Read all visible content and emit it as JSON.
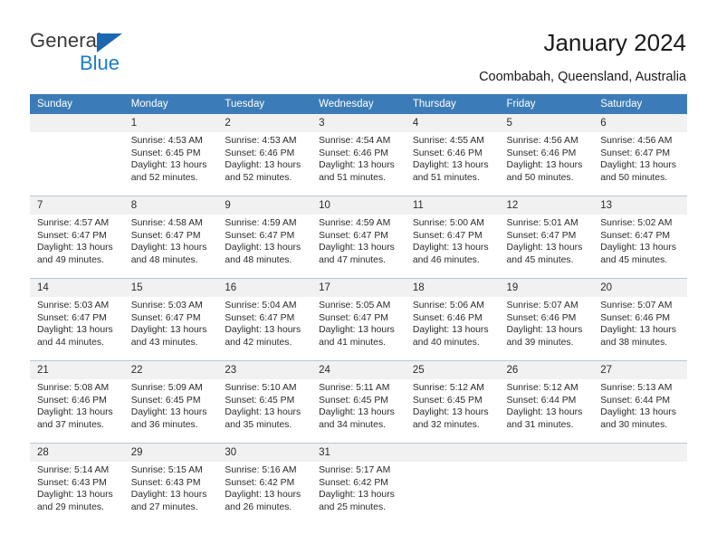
{
  "brand": {
    "word_one": "General",
    "word_two": "Blue",
    "accent_color": "#1b7cc4",
    "triangle_color": "#1b67b0"
  },
  "header": {
    "title": "January 2024",
    "subtitle": "Coombabah, Queensland, Australia",
    "header_bg_color": "#3b7cb8",
    "daynum_bg_color": "#f1f1f1"
  },
  "weekday_headers": [
    "Sunday",
    "Monday",
    "Tuesday",
    "Wednesday",
    "Thursday",
    "Friday",
    "Saturday"
  ],
  "weeks": [
    [
      {
        "day": "",
        "sunrise": "",
        "sunset": "",
        "daylight_line1": "",
        "daylight_line2": ""
      },
      {
        "day": "1",
        "sunrise": "Sunrise: 4:53 AM",
        "sunset": "Sunset: 6:45 PM",
        "daylight_line1": "Daylight: 13 hours",
        "daylight_line2": "and 52 minutes."
      },
      {
        "day": "2",
        "sunrise": "Sunrise: 4:53 AM",
        "sunset": "Sunset: 6:46 PM",
        "daylight_line1": "Daylight: 13 hours",
        "daylight_line2": "and 52 minutes."
      },
      {
        "day": "3",
        "sunrise": "Sunrise: 4:54 AM",
        "sunset": "Sunset: 6:46 PM",
        "daylight_line1": "Daylight: 13 hours",
        "daylight_line2": "and 51 minutes."
      },
      {
        "day": "4",
        "sunrise": "Sunrise: 4:55 AM",
        "sunset": "Sunset: 6:46 PM",
        "daylight_line1": "Daylight: 13 hours",
        "daylight_line2": "and 51 minutes."
      },
      {
        "day": "5",
        "sunrise": "Sunrise: 4:56 AM",
        "sunset": "Sunset: 6:46 PM",
        "daylight_line1": "Daylight: 13 hours",
        "daylight_line2": "and 50 minutes."
      },
      {
        "day": "6",
        "sunrise": "Sunrise: 4:56 AM",
        "sunset": "Sunset: 6:47 PM",
        "daylight_line1": "Daylight: 13 hours",
        "daylight_line2": "and 50 minutes."
      }
    ],
    [
      {
        "day": "7",
        "sunrise": "Sunrise: 4:57 AM",
        "sunset": "Sunset: 6:47 PM",
        "daylight_line1": "Daylight: 13 hours",
        "daylight_line2": "and 49 minutes."
      },
      {
        "day": "8",
        "sunrise": "Sunrise: 4:58 AM",
        "sunset": "Sunset: 6:47 PM",
        "daylight_line1": "Daylight: 13 hours",
        "daylight_line2": "and 48 minutes."
      },
      {
        "day": "9",
        "sunrise": "Sunrise: 4:59 AM",
        "sunset": "Sunset: 6:47 PM",
        "daylight_line1": "Daylight: 13 hours",
        "daylight_line2": "and 48 minutes."
      },
      {
        "day": "10",
        "sunrise": "Sunrise: 4:59 AM",
        "sunset": "Sunset: 6:47 PM",
        "daylight_line1": "Daylight: 13 hours",
        "daylight_line2": "and 47 minutes."
      },
      {
        "day": "11",
        "sunrise": "Sunrise: 5:00 AM",
        "sunset": "Sunset: 6:47 PM",
        "daylight_line1": "Daylight: 13 hours",
        "daylight_line2": "and 46 minutes."
      },
      {
        "day": "12",
        "sunrise": "Sunrise: 5:01 AM",
        "sunset": "Sunset: 6:47 PM",
        "daylight_line1": "Daylight: 13 hours",
        "daylight_line2": "and 45 minutes."
      },
      {
        "day": "13",
        "sunrise": "Sunrise: 5:02 AM",
        "sunset": "Sunset: 6:47 PM",
        "daylight_line1": "Daylight: 13 hours",
        "daylight_line2": "and 45 minutes."
      }
    ],
    [
      {
        "day": "14",
        "sunrise": "Sunrise: 5:03 AM",
        "sunset": "Sunset: 6:47 PM",
        "daylight_line1": "Daylight: 13 hours",
        "daylight_line2": "and 44 minutes."
      },
      {
        "day": "15",
        "sunrise": "Sunrise: 5:03 AM",
        "sunset": "Sunset: 6:47 PM",
        "daylight_line1": "Daylight: 13 hours",
        "daylight_line2": "and 43 minutes."
      },
      {
        "day": "16",
        "sunrise": "Sunrise: 5:04 AM",
        "sunset": "Sunset: 6:47 PM",
        "daylight_line1": "Daylight: 13 hours",
        "daylight_line2": "and 42 minutes."
      },
      {
        "day": "17",
        "sunrise": "Sunrise: 5:05 AM",
        "sunset": "Sunset: 6:47 PM",
        "daylight_line1": "Daylight: 13 hours",
        "daylight_line2": "and 41 minutes."
      },
      {
        "day": "18",
        "sunrise": "Sunrise: 5:06 AM",
        "sunset": "Sunset: 6:46 PM",
        "daylight_line1": "Daylight: 13 hours",
        "daylight_line2": "and 40 minutes."
      },
      {
        "day": "19",
        "sunrise": "Sunrise: 5:07 AM",
        "sunset": "Sunset: 6:46 PM",
        "daylight_line1": "Daylight: 13 hours",
        "daylight_line2": "and 39 minutes."
      },
      {
        "day": "20",
        "sunrise": "Sunrise: 5:07 AM",
        "sunset": "Sunset: 6:46 PM",
        "daylight_line1": "Daylight: 13 hours",
        "daylight_line2": "and 38 minutes."
      }
    ],
    [
      {
        "day": "21",
        "sunrise": "Sunrise: 5:08 AM",
        "sunset": "Sunset: 6:46 PM",
        "daylight_line1": "Daylight: 13 hours",
        "daylight_line2": "and 37 minutes."
      },
      {
        "day": "22",
        "sunrise": "Sunrise: 5:09 AM",
        "sunset": "Sunset: 6:45 PM",
        "daylight_line1": "Daylight: 13 hours",
        "daylight_line2": "and 36 minutes."
      },
      {
        "day": "23",
        "sunrise": "Sunrise: 5:10 AM",
        "sunset": "Sunset: 6:45 PM",
        "daylight_line1": "Daylight: 13 hours",
        "daylight_line2": "and 35 minutes."
      },
      {
        "day": "24",
        "sunrise": "Sunrise: 5:11 AM",
        "sunset": "Sunset: 6:45 PM",
        "daylight_line1": "Daylight: 13 hours",
        "daylight_line2": "and 34 minutes."
      },
      {
        "day": "25",
        "sunrise": "Sunrise: 5:12 AM",
        "sunset": "Sunset: 6:45 PM",
        "daylight_line1": "Daylight: 13 hours",
        "daylight_line2": "and 32 minutes."
      },
      {
        "day": "26",
        "sunrise": "Sunrise: 5:12 AM",
        "sunset": "Sunset: 6:44 PM",
        "daylight_line1": "Daylight: 13 hours",
        "daylight_line2": "and 31 minutes."
      },
      {
        "day": "27",
        "sunrise": "Sunrise: 5:13 AM",
        "sunset": "Sunset: 6:44 PM",
        "daylight_line1": "Daylight: 13 hours",
        "daylight_line2": "and 30 minutes."
      }
    ],
    [
      {
        "day": "28",
        "sunrise": "Sunrise: 5:14 AM",
        "sunset": "Sunset: 6:43 PM",
        "daylight_line1": "Daylight: 13 hours",
        "daylight_line2": "and 29 minutes."
      },
      {
        "day": "29",
        "sunrise": "Sunrise: 5:15 AM",
        "sunset": "Sunset: 6:43 PM",
        "daylight_line1": "Daylight: 13 hours",
        "daylight_line2": "and 27 minutes."
      },
      {
        "day": "30",
        "sunrise": "Sunrise: 5:16 AM",
        "sunset": "Sunset: 6:42 PM",
        "daylight_line1": "Daylight: 13 hours",
        "daylight_line2": "and 26 minutes."
      },
      {
        "day": "31",
        "sunrise": "Sunrise: 5:17 AM",
        "sunset": "Sunset: 6:42 PM",
        "daylight_line1": "Daylight: 13 hours",
        "daylight_line2": "and 25 minutes."
      },
      {
        "day": "",
        "sunrise": "",
        "sunset": "",
        "daylight_line1": "",
        "daylight_line2": ""
      },
      {
        "day": "",
        "sunrise": "",
        "sunset": "",
        "daylight_line1": "",
        "daylight_line2": ""
      },
      {
        "day": "",
        "sunrise": "",
        "sunset": "",
        "daylight_line1": "",
        "daylight_line2": ""
      }
    ]
  ]
}
